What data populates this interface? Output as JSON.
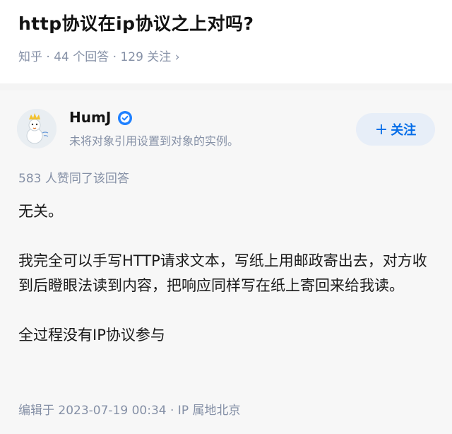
{
  "question": {
    "title": "http协议在ip协议之上对吗?",
    "meta": "知乎 · 44 个回答 · 129 关注 ›"
  },
  "author": {
    "name": "HumJ",
    "bio": "未将对象引用设置到对象的实例。",
    "badge_icon": "verified-badge-icon",
    "avatar_icon": "snowman-avatar"
  },
  "follow_button": {
    "plus": "+",
    "label": "关注"
  },
  "answer": {
    "upvotes": "583 人赞同了该回答",
    "paragraphs": [
      "无关。",
      "我完全可以手写HTTP请求文本，写纸上用邮政寄出去，对方收到后瞪眼法读到内容，把响应同样写在纸上寄回来给我读。",
      "全过程没有IP协议参与"
    ],
    "footer": "编辑于 2023-07-19 00:34 · IP 属地北京"
  },
  "colors": {
    "accent": "#056de8",
    "meta": "#8590a6",
    "button_bg": "#e7eef8"
  }
}
